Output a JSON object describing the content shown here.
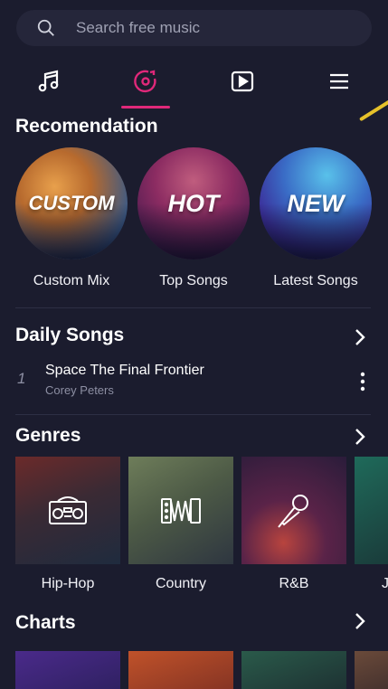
{
  "search": {
    "placeholder": "Search free music"
  },
  "tabs": [
    {
      "icon": "music-note-icon"
    },
    {
      "icon": "disc-icon",
      "active": true
    },
    {
      "icon": "video-play-icon"
    },
    {
      "icon": "menu-icon"
    }
  ],
  "recommendation": {
    "title": "Recomendation",
    "items": [
      {
        "badge": "CUSTOM",
        "label": "Custom Mix"
      },
      {
        "badge": "HOT",
        "label": "Top Songs"
      },
      {
        "badge": "NEW",
        "label": "Latest Songs"
      }
    ]
  },
  "daily_songs": {
    "title": "Daily Songs",
    "songs": [
      {
        "number": "1",
        "title": "Space The Final Frontier",
        "artist": "Corey Peters"
      }
    ]
  },
  "genres": {
    "title": "Genres",
    "items": [
      {
        "label": "Hip-Hop",
        "icon": "boombox-icon"
      },
      {
        "label": "Country",
        "icon": "accordion-icon"
      },
      {
        "label": "R&B",
        "icon": "microphone-icon"
      },
      {
        "label": "J",
        "icon": ""
      }
    ]
  },
  "charts": {
    "title": "Charts"
  },
  "colors": {
    "accent": "#e0287a",
    "background": "#1b1c2e"
  }
}
